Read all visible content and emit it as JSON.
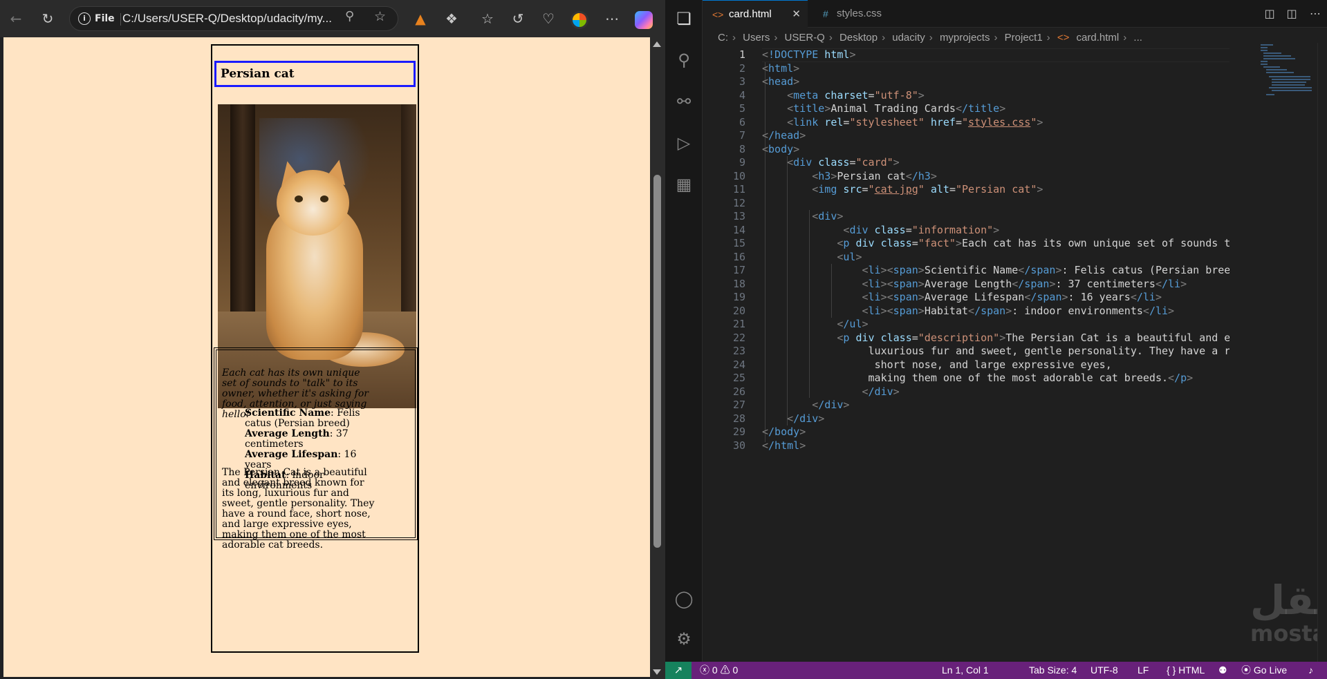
{
  "browser": {
    "address_scheme": "File",
    "url": "C:/Users/USER-Q/Desktop/udacity/my...",
    "icons": [
      "back-arrow-icon",
      "refresh-icon",
      "info-icon",
      "zoom-out-icon",
      "favorite-star-icon",
      "metamask-fox-icon",
      "extensions-puzzle-icon",
      "favorites-icon",
      "history-icon",
      "performance-heart-icon",
      "profile-icon",
      "more-icon",
      "copilot-icon"
    ],
    "more_label": "⋯"
  },
  "page": {
    "card_title": "Persian cat",
    "image_alt": "Persian cat",
    "fact": "Each cat has its own unique set of sounds to \"talk\" to its owner, whether it's asking for food, attention, or just saying hello!",
    "facts": [
      {
        "label": "Scientific Name",
        "value": ": Felis catus (Persian breed)"
      },
      {
        "label": "Average Length",
        "value": ": 37 centimeters"
      },
      {
        "label": "Average Lifespan",
        "value": ": 16 years"
      },
      {
        "label": "Habitat",
        "value": ": indoor environments"
      }
    ],
    "description": "The Persian Cat is a beautiful and elegant breed known for its long, luxurious fur and sweet, gentle personality. They have a round face, short nose, and large expressive eyes, making them one of the most adorable cat breeds."
  },
  "editor": {
    "tabs": [
      {
        "label": "card.html",
        "icon": "<>",
        "close": "✕"
      },
      {
        "label": "styles.css",
        "icon": "#"
      }
    ],
    "breadcrumb": [
      "C:",
      "Users",
      "USER-Q",
      "Desktop",
      "udacity",
      "myprojects",
      "Project1",
      "card.html",
      "..."
    ],
    "breadcrumb_file_icon": "<>",
    "line_numbers": [
      "1",
      "2",
      "3",
      "4",
      "5",
      "6",
      "7",
      "8",
      "9",
      "10",
      "11",
      "12",
      "13",
      "14",
      "15",
      "16",
      "17",
      "18",
      "19",
      "20",
      "21",
      "22",
      "23",
      "24",
      "25",
      "26",
      "27",
      "28",
      "29",
      "30"
    ],
    "code": {
      "l1_tag": "!DOCTYPE",
      "l1_attr": " html",
      "l2": "html",
      "l3": "head",
      "l4_tag": "meta",
      "l4_attr": " charset",
      "l4_val": "\"utf-8\"",
      "l5_tag": "title",
      "l5_text": "Animal Trading Cards",
      "l5_close": "/title",
      "l6_tag": "link",
      "l6_a1": " rel",
      "l6_v1": "\"stylesheet\"",
      "l6_a2": " href",
      "l6_v2": "styles.css",
      "l7": "/head",
      "l8": "body",
      "l9_tag": "div",
      "l9_attr": " class",
      "l9_val": "\"card\"",
      "l10_tag": "h3",
      "l10_text": "Persian cat",
      "l10_close": "/h3",
      "l11_tag": "img",
      "l11_a1": " src",
      "l11_v1": "cat.jpg",
      "l11_a2": " alt",
      "l11_v2": "\"Persian cat\"",
      "l13": "div",
      "l14_tag": "div",
      "l14_attr": " class",
      "l14_val": "\"information\"",
      "l15_tag": "p",
      "l15_a1": " div class",
      "l15_val": "\"fact\"",
      "l15_text": "Each cat has its own unique set of sounds t",
      "l16": "ul",
      "l17_text": "Scientific Name",
      "l17_rest": ": Felis catus (Persian bree",
      "l18_text": "Average Length",
      "l18_rest": ": 37 centimeters",
      "l19_text": "Average Lifespan",
      "l19_rest": ": 16 years",
      "l20_text": "Habitat",
      "l20_rest": ": indoor environments",
      "l21": "/ul",
      "l22_tag": "p",
      "l22_a1": " div class",
      "l22_val": "\"description\"",
      "l22_text": "The Persian Cat is a beautiful and e",
      "l23": "luxurious fur and sweet, gentle personality. They have a r",
      "l24": "short nose, and large expressive eyes,",
      "l25": "making them one of the most adorable cat breeds.",
      "l25_close": "/p",
      "l26": "/div",
      "l27": "/div",
      "l28": "/div",
      "l29": "/body",
      "l30": "/html",
      "li": "li",
      "li_close": "/li",
      "span": "span",
      "span_close": "/span"
    }
  },
  "watermark": {
    "arabic": "مستقل",
    "latin": "mostaql.com"
  },
  "status_bar": {
    "remote_icon": "↗",
    "problems": "ⓧ 0 ⚠ 0",
    "position": "Ln 1, Col 1",
    "tab_size": "Tab Size: 4",
    "encoding": "UTF-8",
    "eol": "LF",
    "language": "{ } HTML",
    "copilot": "⚉",
    "go_live": "Go Live",
    "go_live_icon": "⦿",
    "bell": "♪"
  },
  "colors": {
    "page_bg": "#ffe4c4",
    "status_bar": "#68217a",
    "remote": "#16825d",
    "title_border": "#1a1aff"
  }
}
